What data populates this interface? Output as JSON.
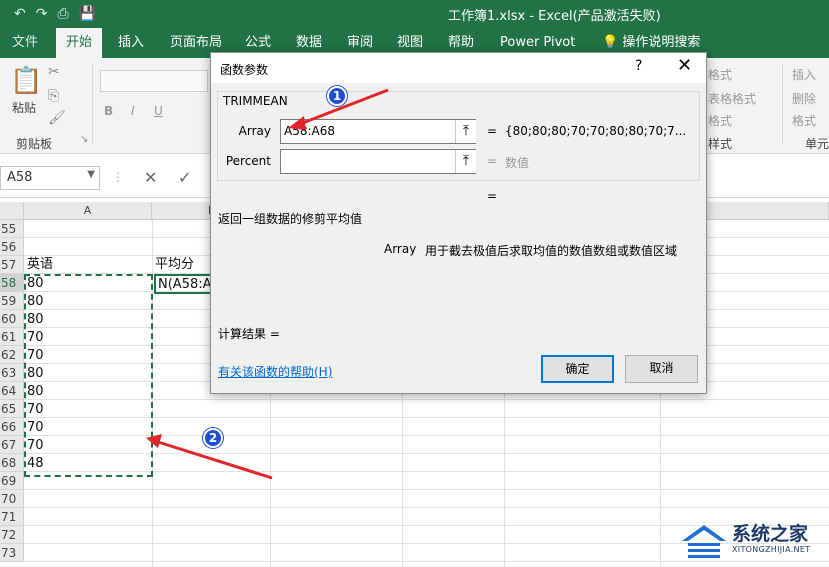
{
  "window": {
    "title": "工作簿1.xlsx  -  Excel(产品激活失败)",
    "qat": [
      "↶",
      "↷",
      "⎙",
      "💾"
    ]
  },
  "ribbon": {
    "tabs": [
      "文件",
      "开始",
      "插入",
      "页面布局",
      "公式",
      "数据",
      "审阅",
      "视图",
      "帮助",
      "Power Pivot",
      "操作说明搜索"
    ],
    "active_tab": "开始",
    "paste_label": "粘贴",
    "clipboard_group": "剪贴板",
    "font_bold": "B",
    "font_italic": "I",
    "font_underline": "U",
    "format_labels": [
      "格式",
      "表格格式",
      "格式",
      "样式"
    ],
    "cells_labels": [
      "插入",
      "删除",
      "格式",
      "单元"
    ]
  },
  "formula_bar": {
    "name_box": "A58",
    "cancel": "✕",
    "enter": "✓"
  },
  "sheet": {
    "columns": [
      "A",
      "B"
    ],
    "rows": [
      "55",
      "56",
      "57",
      "58",
      "59",
      "60",
      "61",
      "62",
      "63",
      "64",
      "65",
      "66",
      "67",
      "68",
      "69",
      "70",
      "71",
      "72",
      "73"
    ],
    "header_a": "英语",
    "header_b": "平均分",
    "values": [
      "80",
      "80",
      "80",
      "70",
      "70",
      "80",
      "80",
      "70",
      "70",
      "70",
      "48"
    ],
    "b58_formula": "N(A58:A"
  },
  "dialog": {
    "title": "函数参数",
    "help_btn": "?",
    "close_btn": "✕",
    "function_name": "TRIMMEAN",
    "args": [
      {
        "label": "Array",
        "value": "A58:A68",
        "result": "{80;80;80;70;70;80;80;70;7..."
      },
      {
        "label": "Percent",
        "value": "",
        "result": "数值"
      }
    ],
    "equals": "=",
    "description": "返回一组数据的修剪平均值",
    "arg_help_name": "Array",
    "arg_help_text": "用于截去极值后求取均值的数值数组或数值区域",
    "result_label": "计算结果 =",
    "help_link": "有关该函数的帮助(H)",
    "ok": "确定",
    "cancel": "取消"
  },
  "annotations": {
    "badge1": "1",
    "badge2": "2",
    "arrow_color": "#e0262b"
  },
  "watermark": {
    "text": "系统之家",
    "sub": "XITONGZHIJIA.NET"
  }
}
